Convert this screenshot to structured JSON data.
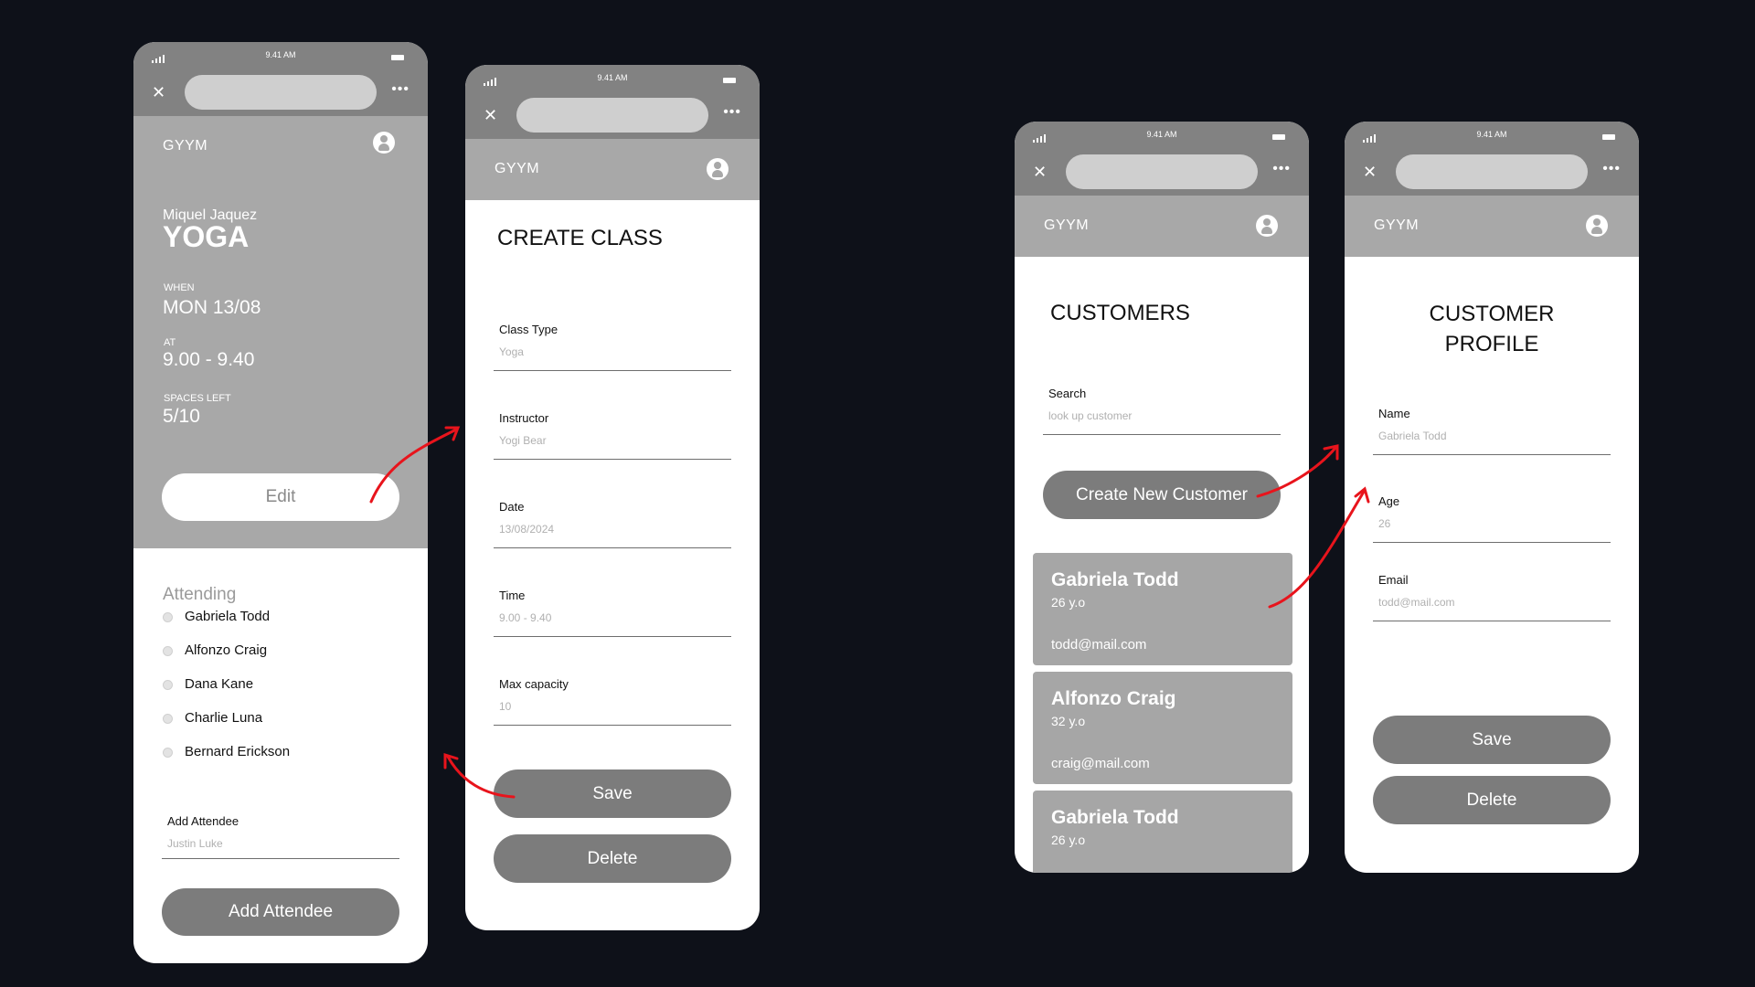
{
  "common": {
    "time": "9.41 AM",
    "brand": "GYYM",
    "close_glyph": "✕",
    "more_glyph": "•••"
  },
  "class_detail": {
    "instructor": "Miquel Jaquez",
    "class_name": "YOGA",
    "when_label": "WHEN",
    "when_value": "MON 13/08",
    "at_label": "AT",
    "at_value": "9.00 - 9.40",
    "spaces_label": "SPACES LEFT",
    "spaces_value": "5/10",
    "edit_button": "Edit",
    "attending_label": "Attending",
    "attendees": [
      "Gabriela Todd",
      "Alfonzo Craig",
      "Dana Kane",
      "Charlie Luna",
      "Bernard Erickson"
    ],
    "add_attendee_label": "Add Attendee",
    "add_attendee_placeholder": "Justin Luke",
    "add_attendee_button": "Add Attendee"
  },
  "create_class": {
    "title": "CREATE CLASS",
    "fields": [
      {
        "label": "Class Type",
        "value": "Yoga"
      },
      {
        "label": "Instructor",
        "value": "Yogi Bear"
      },
      {
        "label": "Date",
        "value": "13/08/2024"
      },
      {
        "label": "Time",
        "value": "9.00 - 9.40"
      },
      {
        "label": "Max capacity",
        "value": "10"
      }
    ],
    "save_button": "Save",
    "delete_button": "Delete"
  },
  "customers": {
    "title": "CUSTOMERS",
    "search_label": "Search",
    "search_placeholder": "look up customer",
    "create_button": "Create New Customer",
    "list": [
      {
        "name": "Gabriela Todd",
        "age": "26 y.o",
        "email": "todd@mail.com"
      },
      {
        "name": "Alfonzo Craig",
        "age": "32 y.o",
        "email": "craig@mail.com"
      },
      {
        "name": "Gabriela Todd",
        "age": "26 y.o",
        "email": ""
      }
    ]
  },
  "customer_profile": {
    "title_line1": "CUSTOMER",
    "title_line2": "PROFILE",
    "fields": [
      {
        "label": "Name",
        "value": "Gabriela Todd"
      },
      {
        "label": "Age",
        "value": "26"
      },
      {
        "label": "Email",
        "value": "todd@mail.com"
      }
    ],
    "save_button": "Save",
    "delete_button": "Delete"
  },
  "colors": {
    "background": "#0e1119",
    "arrow": "#e8141c",
    "header_gray": "#a8a8a8",
    "button_gray": "#7c7c7c"
  }
}
